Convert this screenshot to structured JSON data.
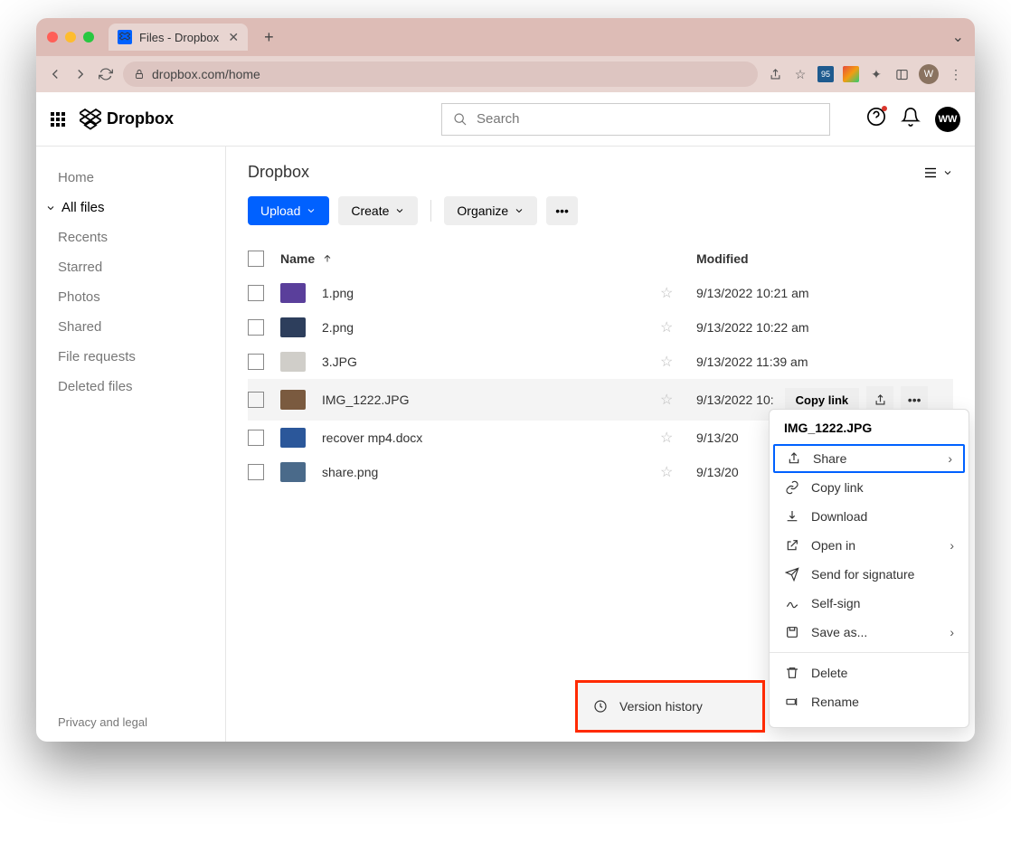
{
  "browser": {
    "tab_title": "Files - Dropbox",
    "url": "dropbox.com/home",
    "avatar_initial": "W"
  },
  "header": {
    "logo_text": "Dropbox",
    "search_placeholder": "Search",
    "avatar_initials": "WW"
  },
  "sidebar": {
    "items": [
      {
        "label": "Home"
      },
      {
        "label": "All files"
      },
      {
        "label": "Recents"
      },
      {
        "label": "Starred"
      },
      {
        "label": "Photos"
      },
      {
        "label": "Shared"
      },
      {
        "label": "File requests"
      },
      {
        "label": "Deleted files"
      }
    ]
  },
  "main": {
    "title": "Dropbox",
    "upload": "Upload",
    "create": "Create",
    "organize": "Organize",
    "col_name": "Name",
    "col_modified": "Modified",
    "copy_link": "Copy link",
    "files": [
      {
        "name": "1.png",
        "modified": "9/13/2022 10:21 am",
        "thumb": "#5a3f9b"
      },
      {
        "name": "2.png",
        "modified": "9/13/2022 10:22 am",
        "thumb": "#2d3e5c"
      },
      {
        "name": "3.JPG",
        "modified": "9/13/2022 11:39 am",
        "thumb": "#d0cec9"
      },
      {
        "name": "IMG_1222.JPG",
        "modified": "9/13/2022 10:",
        "thumb": "#7a5a3f"
      },
      {
        "name": "recover mp4.docx",
        "modified": "9/13/20",
        "thumb": "#2b579a"
      },
      {
        "name": "share.png",
        "modified": "9/13/20",
        "thumb": "#4a6a8a"
      }
    ]
  },
  "menu": {
    "title": "IMG_1222.JPG",
    "share": "Share",
    "copy_link": "Copy link",
    "download": "Download",
    "open_in": "Open in",
    "send_signature": "Send for signature",
    "self_sign": "Self-sign",
    "save_as": "Save as...",
    "delete": "Delete",
    "rename": "Rename"
  },
  "submenu": {
    "version_history": "Version history"
  },
  "footer": {
    "privacy": "Privacy and legal"
  }
}
